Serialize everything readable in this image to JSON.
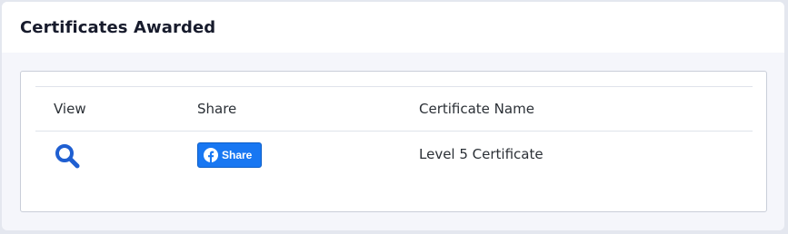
{
  "card": {
    "title": "Certificates Awarded"
  },
  "table": {
    "columns": [
      "View",
      "Share",
      "Certificate Name"
    ],
    "rows": [
      {
        "view_icon": "search-icon",
        "share_label": "Share",
        "share_icon": "facebook-icon",
        "certificate_name": "Level 5 Certificate"
      }
    ]
  },
  "colors": {
    "accent": "#1877f2",
    "view_icon": "#1f5fd1"
  }
}
